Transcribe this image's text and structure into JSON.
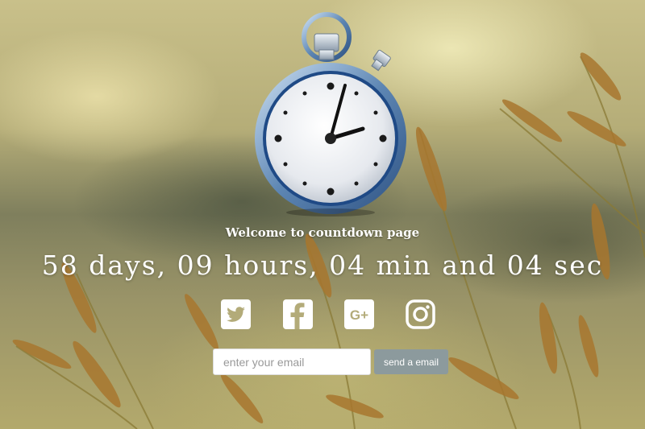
{
  "page": {
    "welcome_text": "Welcome to countdown page",
    "countdown_text": "58 days, 09 hours, 04 min and 04 sec"
  },
  "social": [
    {
      "name": "twitter",
      "icon": "twitter-icon"
    },
    {
      "name": "facebook",
      "icon": "facebook-icon"
    },
    {
      "name": "google-plus",
      "icon": "google-plus-icon",
      "label": "G+"
    },
    {
      "name": "instagram",
      "icon": "instagram-icon"
    }
  ],
  "subscribe": {
    "placeholder": "enter your email",
    "value": "",
    "button_label": "send a email"
  },
  "colors": {
    "text": "#ffffff",
    "button": "#8c9a9d",
    "icon_bg": "#ffffff",
    "icon_fg": "#b3ab79"
  }
}
